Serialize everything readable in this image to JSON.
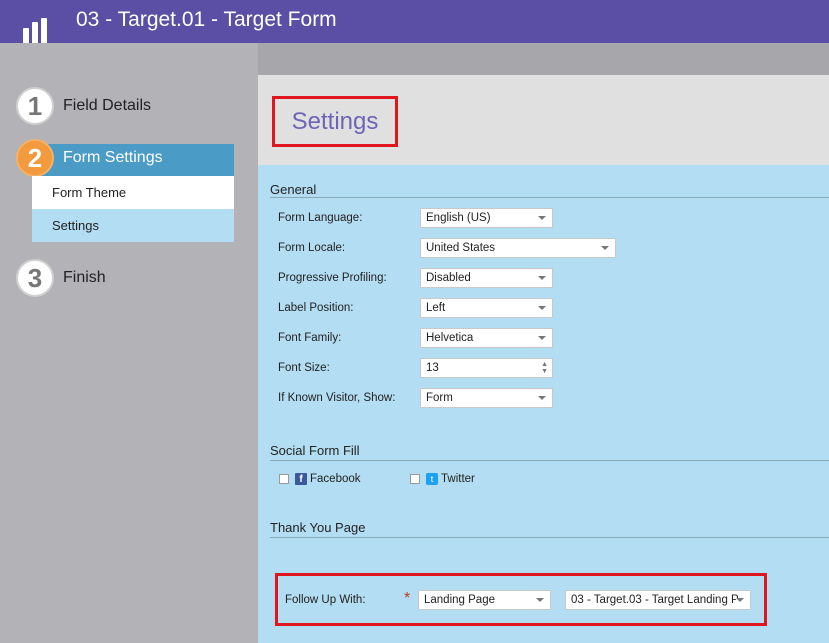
{
  "header": {
    "title": "03 - Target.01 - Target Form"
  },
  "wizard": {
    "steps": [
      {
        "number": "1",
        "label": "Field Details"
      },
      {
        "number": "2",
        "label": "Form Settings"
      },
      {
        "number": "3",
        "label": "Finish"
      }
    ],
    "substeps": [
      "Form Theme",
      "Settings"
    ]
  },
  "settings": {
    "title": "Settings"
  },
  "general": {
    "title": "General",
    "rows": [
      {
        "label": "Form Language:",
        "value": "English (US)"
      },
      {
        "label": "Form Locale:",
        "value": "United States"
      },
      {
        "label": "Progressive Profiling:",
        "value": "Disabled"
      },
      {
        "label": "Label Position:",
        "value": "Left"
      },
      {
        "label": "Font Family:",
        "value": "Helvetica"
      },
      {
        "label": "Font Size:",
        "value": "13"
      },
      {
        "label": "If Known Visitor, Show:",
        "value": "Form"
      }
    ]
  },
  "social": {
    "title": "Social Form Fill",
    "facebook_label": "Facebook",
    "twitter_label": "Twitter",
    "facebook_icon": "f",
    "twitter_icon": "t"
  },
  "thankyou": {
    "title": "Thank You Page",
    "follow_label": "Follow Up With:",
    "required_mark": "*",
    "type_value": "Landing Page",
    "page_value": "03 - Target.03 - Target Landing P"
  },
  "colors": {
    "header": "#5b4ea5",
    "accent_orange": "#f29a3c",
    "accent_blue": "#4a9bc6",
    "highlight": "#e0161e"
  }
}
